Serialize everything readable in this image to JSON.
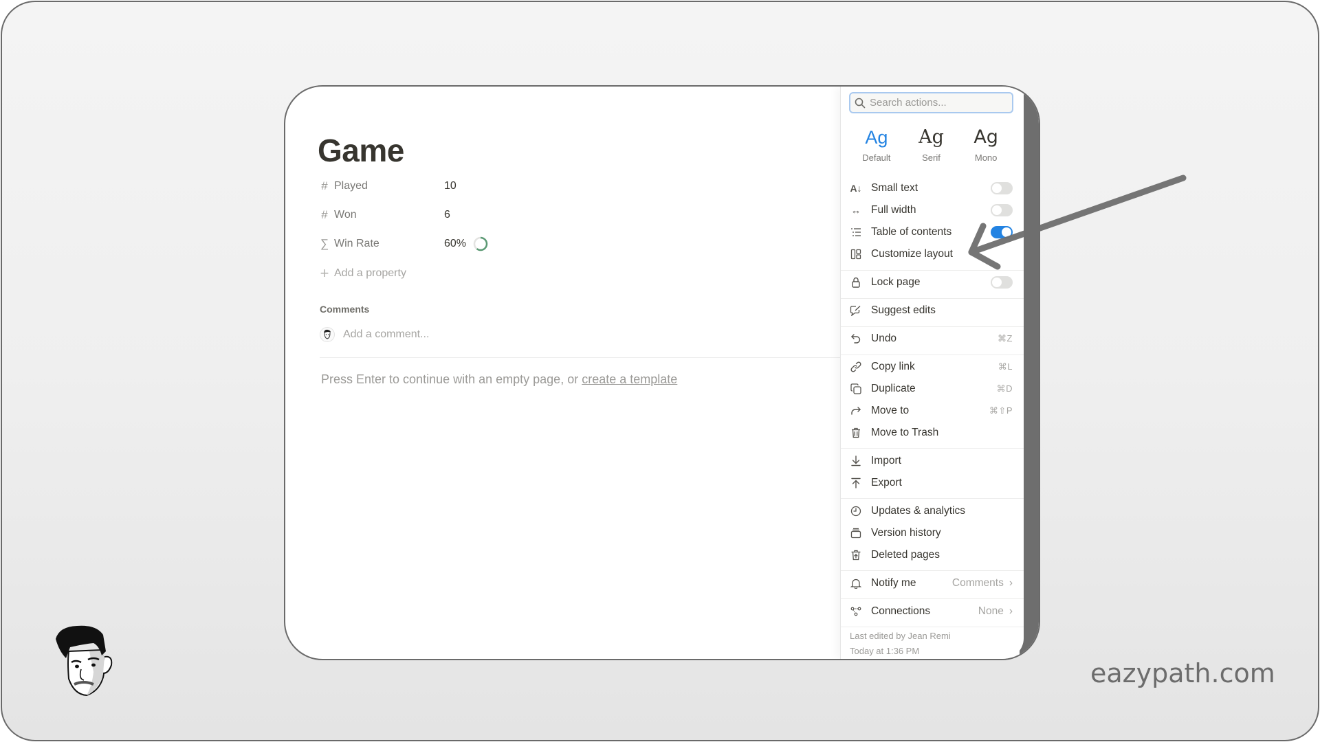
{
  "page": {
    "title": "Game",
    "properties": [
      {
        "icon": "hash-icon",
        "glyph": "#",
        "name": "Played",
        "value": "10"
      },
      {
        "icon": "hash-icon",
        "glyph": "#",
        "name": "Won",
        "value": "6"
      },
      {
        "icon": "sigma-icon",
        "glyph": "∑",
        "name": "Win Rate",
        "value": "60%",
        "progress": 0.6
      }
    ],
    "add_property_label": "Add a property",
    "comments_header": "Comments",
    "comment_placeholder": "Add a comment...",
    "empty_hint_prefix": "Press Enter to continue with an empty page, or ",
    "empty_hint_link": "create a template"
  },
  "menu": {
    "search_placeholder": "Search actions...",
    "fonts": [
      {
        "sample": "Ag",
        "label": "Default",
        "active": true
      },
      {
        "sample": "Ag",
        "label": "Serif",
        "active": false
      },
      {
        "sample": "Ag",
        "label": "Mono",
        "active": false
      }
    ],
    "toggles": [
      {
        "label": "Small text",
        "on": false
      },
      {
        "label": "Full width",
        "on": false
      },
      {
        "label": "Table of contents",
        "on": true
      }
    ],
    "customize_layout": "Customize layout",
    "lock_page": {
      "label": "Lock page",
      "on": false
    },
    "suggest_edits": "Suggest edits",
    "undo": {
      "label": "Undo",
      "shortcut": "⌘Z"
    },
    "actions": [
      {
        "label": "Copy link",
        "shortcut": "⌘L"
      },
      {
        "label": "Duplicate",
        "shortcut": "⌘D"
      },
      {
        "label": "Move to",
        "shortcut": "⌘⇧P"
      },
      {
        "label": "Move to Trash",
        "shortcut": ""
      }
    ],
    "import": "Import",
    "export": "Export",
    "history": [
      {
        "label": "Updates & analytics"
      },
      {
        "label": "Version history"
      },
      {
        "label": "Deleted pages"
      }
    ],
    "notify": {
      "label": "Notify me",
      "value": "Comments"
    },
    "connections": {
      "label": "Connections",
      "value": "None"
    },
    "footer_line1": "Last edited by Jean Remi",
    "footer_line2": "Today at 1:36 PM"
  },
  "watermark": "eazypath.com",
  "colors": {
    "accent": "#2383e2",
    "progress": "#5b9a74",
    "text": "#37352f"
  }
}
